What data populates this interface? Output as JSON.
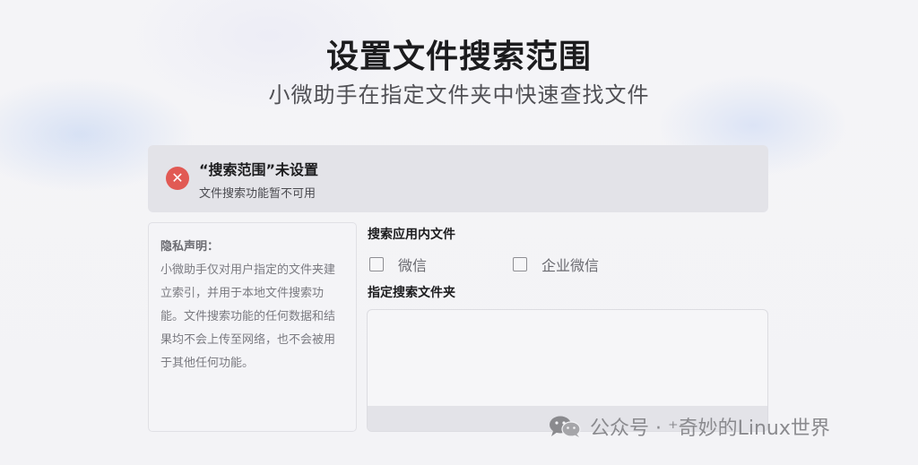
{
  "header": {
    "title": "设置文件搜索范围",
    "subtitle": "小微助手在指定文件夹中快速查找文件"
  },
  "alert": {
    "icon": "error-x-icon",
    "icon_glyph": "✕",
    "icon_color": "#e15a54",
    "title": "“搜索范围”未设置",
    "description": "文件搜索功能暂不可用"
  },
  "privacy": {
    "title": "隐私声明：",
    "body": "小微助手仅对用户指定的文件夹建立索引，并用于本地文件搜索功能。文件搜索功能的任何数据和结果均不会上传至网络，也不会被用于其他任何功能。"
  },
  "search_apps": {
    "label": "搜索应用内文件",
    "options": [
      {
        "label": "微信",
        "checked": false
      },
      {
        "label": "企业微信",
        "checked": false
      }
    ]
  },
  "folders": {
    "label": "指定搜索文件夹"
  },
  "watermark": {
    "icon": "wechat-icon",
    "text": "公众号 · ⁺奇妙的Linux世界"
  }
}
